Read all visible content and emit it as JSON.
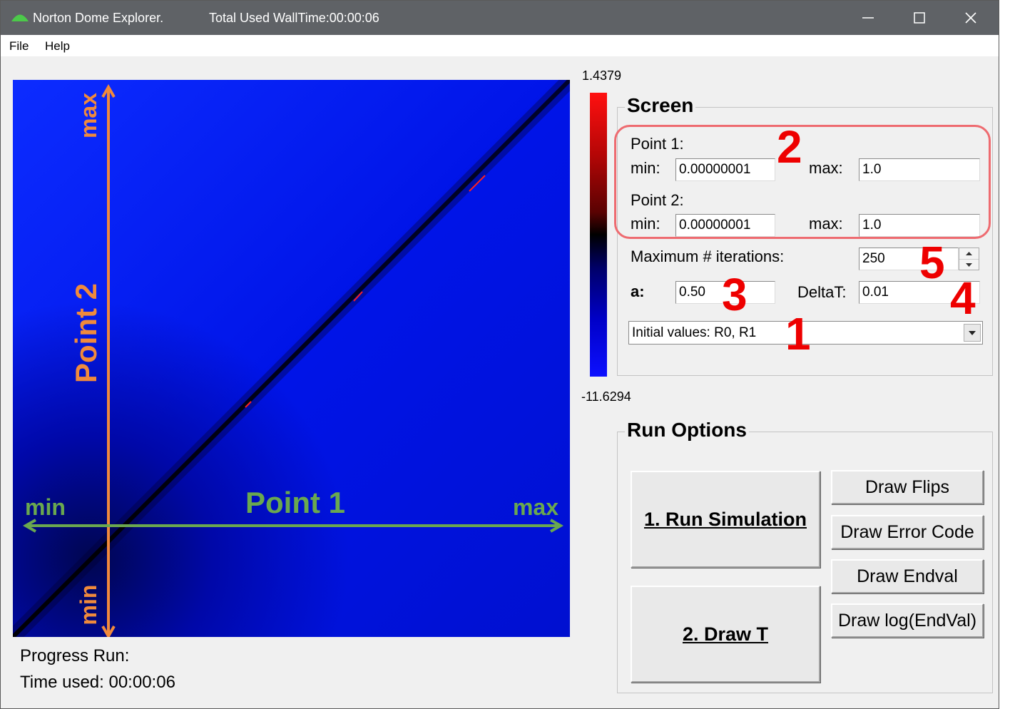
{
  "window": {
    "title": "Norton Dome Explorer.",
    "walltime": "Total Used WallTime:00:00:06",
    "controls": {
      "minimize_icon": "minimize-icon",
      "maximize_icon": "maximize-icon",
      "close_icon": "close-icon"
    }
  },
  "menu": {
    "file": "File",
    "help": "Help"
  },
  "plot": {
    "x_axis": {
      "label": "Point 1",
      "min": "min",
      "max": "max",
      "color": "#6aa84f"
    },
    "y_axis": {
      "label": "Point 2",
      "min": "min",
      "max": "max",
      "color": "#f08a3c"
    }
  },
  "colorbar": {
    "max_label": "1.4379",
    "min_label": "-11.6294"
  },
  "screen": {
    "title": "Screen",
    "point1": {
      "label": "Point 1:",
      "min_label": "min:",
      "min_value": "0.00000001",
      "max_label": "max:",
      "max_value": "1.0"
    },
    "point2": {
      "label": "Point 2:",
      "min_label": "min:",
      "min_value": "0.00000001",
      "max_label": "max:",
      "max_value": "1.0"
    },
    "iterations": {
      "label": "Maximum # iterations:",
      "value": "250"
    },
    "a": {
      "label": "a:",
      "value": "0.50"
    },
    "deltat": {
      "label": "DeltaT:",
      "value": "0.01"
    },
    "initial_values": {
      "selected": "Initial values: R0, R1"
    }
  },
  "annotations": {
    "n1": "1",
    "n2": "2",
    "n3": "3",
    "n4": "4",
    "n5": "5",
    "color": "#ee0000"
  },
  "run_options": {
    "title": "Run Options",
    "run_simulation": "1. Run Simulation",
    "draw_t": "2. Draw T",
    "draw_flips": "Draw Flips",
    "draw_error_code": "Draw Error Code",
    "draw_endval": "Draw Endval",
    "draw_log_endval": "Draw log(EndVal)"
  },
  "status": {
    "progress_label": "Progress Run:",
    "time_used": "Time used:  00:00:06"
  }
}
